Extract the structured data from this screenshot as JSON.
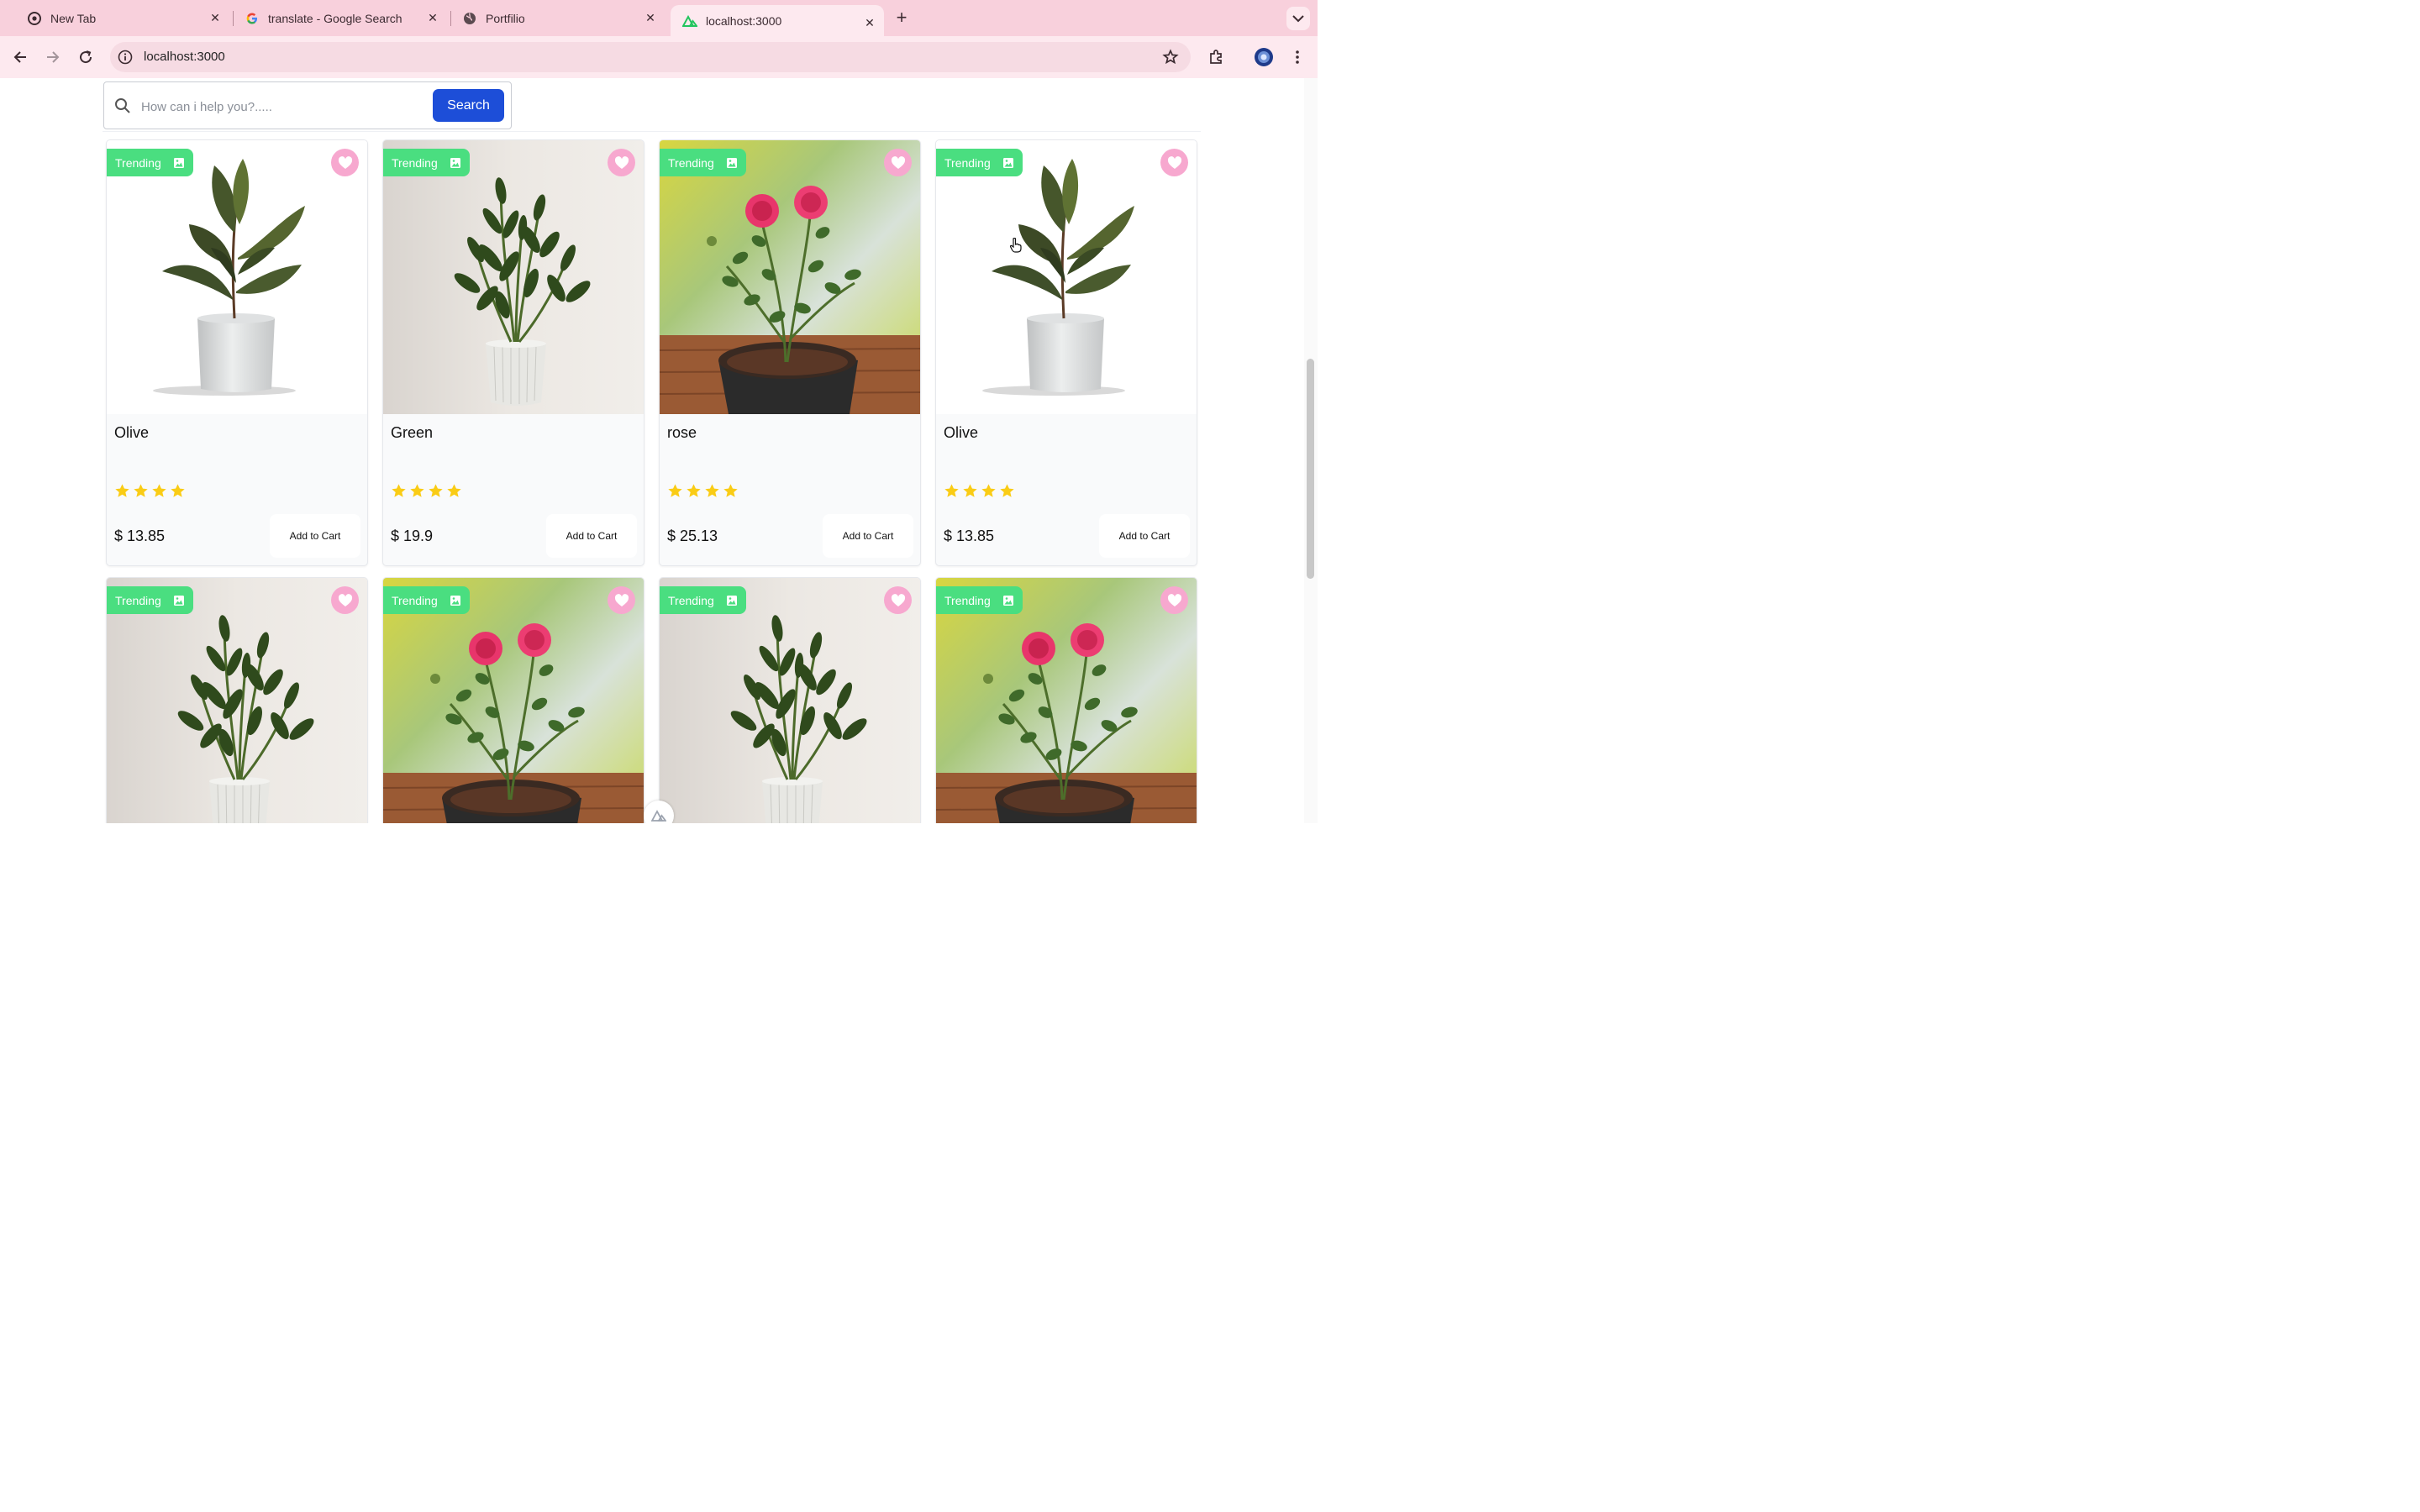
{
  "browser": {
    "tabs": [
      {
        "title": "New Tab",
        "icon": "chrome-icon"
      },
      {
        "title": "translate - Google Search",
        "icon": "google-icon"
      },
      {
        "title": "Portfilio",
        "icon": "globe-icon"
      },
      {
        "title": "localhost:3000",
        "icon": "nuxt-icon"
      }
    ],
    "active_tab": 3,
    "url": "localhost:3000",
    "colors": {
      "tabstrip": "#f8d0dc",
      "toolbar": "#fde9ef"
    }
  },
  "search": {
    "placeholder": "How can i help you?.....",
    "button_label": "Search"
  },
  "colors": {
    "badge": "#4ade80",
    "heart": "#f7a8cf",
    "search_button": "#1d4ed8",
    "star": "#facc15"
  },
  "products": [
    {
      "name": "Olive",
      "price": "$ 13.85",
      "badge": "Trending",
      "cart_label": "Add to Cart",
      "rating": 4,
      "image": "rubber-plant"
    },
    {
      "name": "Green",
      "price": "$ 19.9",
      "badge": "Trending",
      "cart_label": "Add to Cart",
      "rating": 4,
      "image": "zz-plant"
    },
    {
      "name": "rose",
      "price": "$ 25.13",
      "badge": "Trending",
      "cart_label": "Add to Cart",
      "rating": 4,
      "image": "rose-plant"
    },
    {
      "name": "Olive",
      "price": "$ 13.85",
      "badge": "Trending",
      "cart_label": "Add to Cart",
      "rating": 4,
      "image": "rubber-plant"
    },
    {
      "badge": "Trending",
      "image": "zz-plant"
    },
    {
      "badge": "Trending",
      "image": "rose-plant"
    },
    {
      "badge": "Trending",
      "image": "zz-plant"
    },
    {
      "badge": "Trending",
      "image": "rose-plant"
    }
  ]
}
